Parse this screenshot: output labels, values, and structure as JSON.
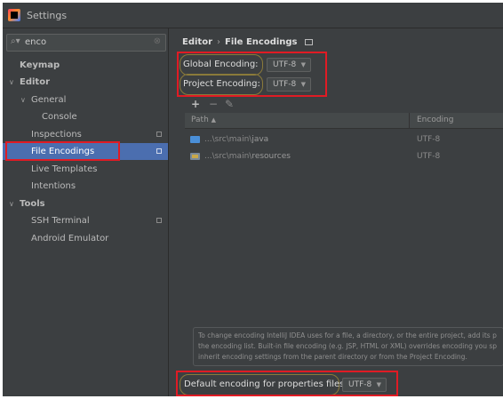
{
  "window": {
    "title": "Settings"
  },
  "search": {
    "value": "enco",
    "icon": "search-icon",
    "clear_icon": "clear-icon"
  },
  "sidebar": {
    "items": [
      {
        "label": "Keymap"
      },
      {
        "label": "Editor"
      },
      {
        "label": "General"
      },
      {
        "label": "Console"
      },
      {
        "label": "Inspections"
      },
      {
        "label": "File Encodings"
      },
      {
        "label": "Live Templates"
      },
      {
        "label": "Intentions"
      },
      {
        "label": "Tools"
      },
      {
        "label": "SSH Terminal"
      },
      {
        "label": "Android Emulator"
      }
    ]
  },
  "breadcrumb": {
    "parent": "Editor",
    "separator": "›",
    "current": "File Encodings"
  },
  "global_encoding": {
    "label": "Global Encoding:",
    "value": "UTF-8"
  },
  "project_encoding": {
    "label": "Project Encoding:",
    "value": "UTF-8"
  },
  "toolbar": {
    "add": "+",
    "remove": "−",
    "edit": "✎"
  },
  "table": {
    "headers": {
      "path": "Path",
      "sort": "▲",
      "encoding": "Encoding"
    },
    "rows": [
      {
        "path_prefix": "...\\src\\main\\",
        "path_leaf": "java",
        "encoding": "UTF-8",
        "icon": "source-folder-icon"
      },
      {
        "path_prefix": "...\\src\\main\\",
        "path_leaf": "resources",
        "encoding": "UTF-8",
        "icon": "resources-folder-icon"
      }
    ]
  },
  "hint": {
    "line1": "To change encoding IntelliJ IDEA uses for a file, a directory, or the entire project, add its p",
    "line2": "the encoding list. Built-in file encoding (e.g. JSP, HTML or XML) overrides encoding you sp",
    "line3": "inherit encoding settings from the parent directory or from the Project Encoding."
  },
  "properties_encoding": {
    "label": "Default encoding for properties files:",
    "value": "UTF-8"
  },
  "colors": {
    "background": "#3c3f41",
    "selection": "#4b6eaf",
    "highlight_box": "#e01b24",
    "folder_blue": "#4a8fd8"
  }
}
